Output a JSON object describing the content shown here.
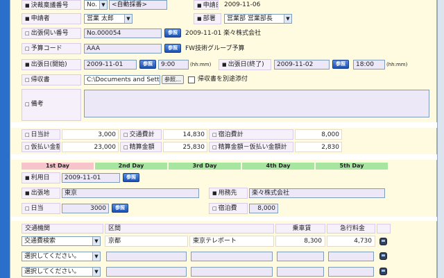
{
  "colors": {
    "accent": "#1c4fb0",
    "day_active": "#f7c4cc",
    "day_inactive": "#a7e6a1",
    "label_bg": "#f6f0fb",
    "panel_bg": "#fffbe0"
  },
  "form": {
    "approval_no": {
      "label": "決裁稟議番号",
      "prefix": "No.",
      "value": "<自動採番>"
    },
    "apply_date": {
      "label": "申請日",
      "value": "2009-11-06"
    },
    "applicant": {
      "label": "申請者",
      "value": "営業 太郎"
    },
    "department": {
      "label": "部署",
      "value": "営業部 営業部長"
    },
    "trip_request_no": {
      "label": "出張伺い番号",
      "value": "No.000054",
      "ref": "参照",
      "info": "2009-11-01 楽々株式会社"
    },
    "budget_code": {
      "label": "予算コード",
      "value": "AAA",
      "ref": "参照",
      "info": "FW技術グループ予算"
    },
    "trip_start": {
      "label": "出張日(開始)",
      "date": "2009-11-01",
      "ref": "参照",
      "time": "9:00",
      "unit": "(hh:mm)"
    },
    "trip_end": {
      "label": "出張日(終了)",
      "date": "2009-11-02",
      "ref": "参照",
      "time": "18:00",
      "unit": "(hh:mm)"
    },
    "report": {
      "label": "帰収書",
      "value": "C:\\Documents and Setting",
      "browse": "参照...",
      "checkbox_label": "帰収書を別途添付"
    },
    "remarks": {
      "label": "備考",
      "value": ""
    }
  },
  "summary": {
    "daily_total": {
      "label": "日当計",
      "value": "3,000"
    },
    "transport_total": {
      "label": "交通費計",
      "value": "14,830"
    },
    "lodging_total": {
      "label": "宿泊費計",
      "value": "8,000"
    },
    "advance_total": {
      "label": "仮払い金額",
      "value": "23,000"
    },
    "settle_total": {
      "label": "精算金額",
      "value": "25,830"
    },
    "diff_total": {
      "label": "精算金額－仮払い金額計",
      "value": "2,830"
    }
  },
  "days": [
    "1st Day",
    "2nd Day",
    "3rd Day",
    "4th Day",
    "5th Day"
  ],
  "day_detail": {
    "use_date": {
      "label": "利用日",
      "value": "2009-11-01",
      "ref": "参照"
    },
    "destination": {
      "label": "出張地",
      "value": "東京"
    },
    "client": {
      "label": "用務先",
      "value": "楽々株式会社"
    },
    "daily": {
      "label": "日当",
      "value": "3000",
      "ref": "参照"
    },
    "lodging": {
      "label": "宿泊費",
      "value": "8,000"
    }
  },
  "transport": {
    "headers": [
      "交通機関",
      "区間",
      "乗車賃",
      "急行料金"
    ],
    "rows": [
      {
        "mode": "交通費検索",
        "from": "京都",
        "to": "東京テレポート",
        "fare": "8,300",
        "express": "4,730"
      },
      {
        "mode": "選択してください。",
        "from": "",
        "to": "",
        "fare": "",
        "express": ""
      },
      {
        "mode": "選択してください。",
        "from": "",
        "to": "",
        "fare": "",
        "express": ""
      }
    ]
  }
}
